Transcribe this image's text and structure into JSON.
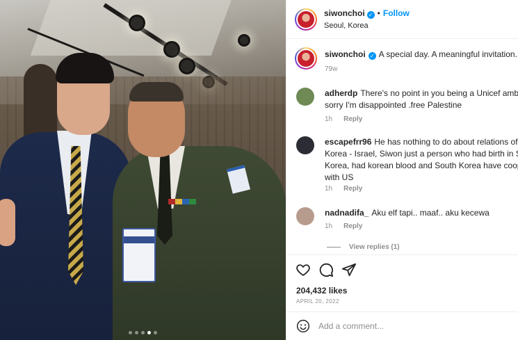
{
  "post": {
    "author": "siwonchoi",
    "follow_label": "Follow",
    "location": "Seoul, Korea",
    "caption": "A special day. A meaningful invitation.",
    "caption_age": "79w",
    "likes": "204,432 likes",
    "date": "APRIL 20, 2022",
    "carousel": {
      "total": 5,
      "active": 4
    }
  },
  "comments": [
    {
      "user": "adherdp",
      "text_line1": "There's no point in you being a Unicef ambas",
      "text_line2": "sorry I'm disappointed .free Palestine",
      "age": "1h",
      "reply": "Reply",
      "avatar_color": "#6f8a55"
    },
    {
      "user": "escapefrr96",
      "text_line1": "He has nothing to do about relations of S",
      "text_line2": "Korea - Israel, Siwon just a person who had birth in Sou",
      "text_line3": "Korea, had korean blood and South Korea have cooper",
      "text_line4": "with US",
      "age": "1h",
      "reply": "Reply",
      "avatar_color": "#2c2c35"
    },
    {
      "user": "nadnadifa_",
      "text_line1": "Aku elf tapi.. maaf.. aku kecewa",
      "age": "1h",
      "reply": "Reply",
      "avatar_color": "#b79b8c"
    }
  ],
  "view_replies": "View replies (1)",
  "add_comment_placeholder": "Add a comment...",
  "icons": [
    "verified-badge-icon",
    "heart-icon",
    "comment-icon",
    "share-icon",
    "emoji-icon"
  ],
  "colors": {
    "accent": "#0095f6",
    "muted": "#8e8e8e",
    "text": "#262626"
  }
}
